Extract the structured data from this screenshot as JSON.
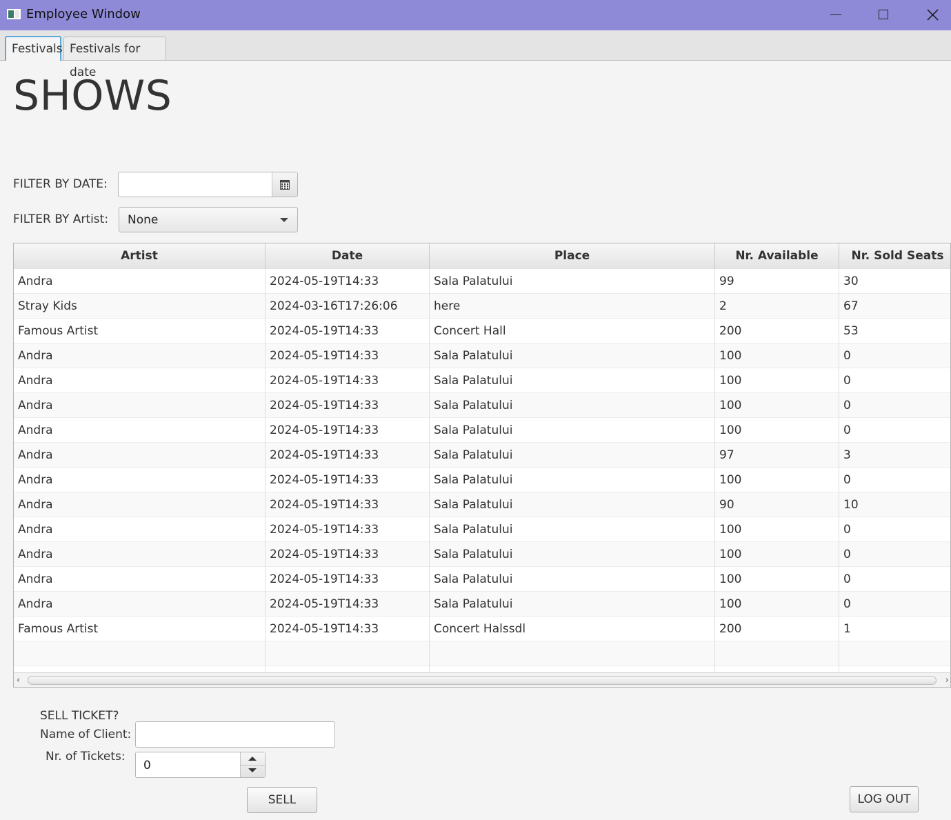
{
  "window": {
    "title": "Employee Window"
  },
  "tabs": [
    {
      "label": "Festivals",
      "active": true
    },
    {
      "label": "Festivals for date",
      "active": false
    }
  ],
  "page_title": "SHOWS",
  "filters": {
    "date_label": "FILTER BY DATE:",
    "date_value": "",
    "artist_label": "FILTER BY Artist:",
    "artist_selected": "None"
  },
  "table": {
    "columns": [
      "Artist",
      "Date",
      "Place",
      "Nr. Available Seats",
      "Nr. Sold Seats"
    ],
    "rows": [
      [
        "Andra",
        "2024-05-19T14:33",
        "Sala Palatului",
        "99",
        "30"
      ],
      [
        "Stray Kids",
        "2024-03-16T17:26:06",
        "here",
        "2",
        "67"
      ],
      [
        "Famous Artist",
        "2024-05-19T14:33",
        "Concert Hall",
        "200",
        "53"
      ],
      [
        "Andra",
        "2024-05-19T14:33",
        "Sala Palatului",
        "100",
        "0"
      ],
      [
        "Andra",
        "2024-05-19T14:33",
        "Sala Palatului",
        "100",
        "0"
      ],
      [
        "Andra",
        "2024-05-19T14:33",
        "Sala Palatului",
        "100",
        "0"
      ],
      [
        "Andra",
        "2024-05-19T14:33",
        "Sala Palatului",
        "100",
        "0"
      ],
      [
        "Andra",
        "2024-05-19T14:33",
        "Sala Palatului",
        "97",
        "3"
      ],
      [
        "Andra",
        "2024-05-19T14:33",
        "Sala Palatului",
        "100",
        "0"
      ],
      [
        "Andra",
        "2024-05-19T14:33",
        "Sala Palatului",
        "90",
        "10"
      ],
      [
        "Andra",
        "2024-05-19T14:33",
        "Sala Palatului",
        "100",
        "0"
      ],
      [
        "Andra",
        "2024-05-19T14:33",
        "Sala Palatului",
        "100",
        "0"
      ],
      [
        "Andra",
        "2024-05-19T14:33",
        "Sala Palatului",
        "100",
        "0"
      ],
      [
        "Andra",
        "2024-05-19T14:33",
        "Sala Palatului",
        "100",
        "0"
      ],
      [
        "Famous Artist",
        "2024-05-19T14:33",
        "Concert Halssdl",
        "200",
        "1"
      ]
    ]
  },
  "sell": {
    "heading": "SELL TICKET?",
    "client_label": "Name of Client:",
    "client_value": "",
    "tickets_label": "Nr. of Tickets:",
    "tickets_value": "0",
    "sell_button": "SELL"
  },
  "logout_button": "LOG OUT",
  "icons": {
    "app": "app-window-icon",
    "calendar": "calendar-icon",
    "dropdown": "chevron-down-icon"
  }
}
